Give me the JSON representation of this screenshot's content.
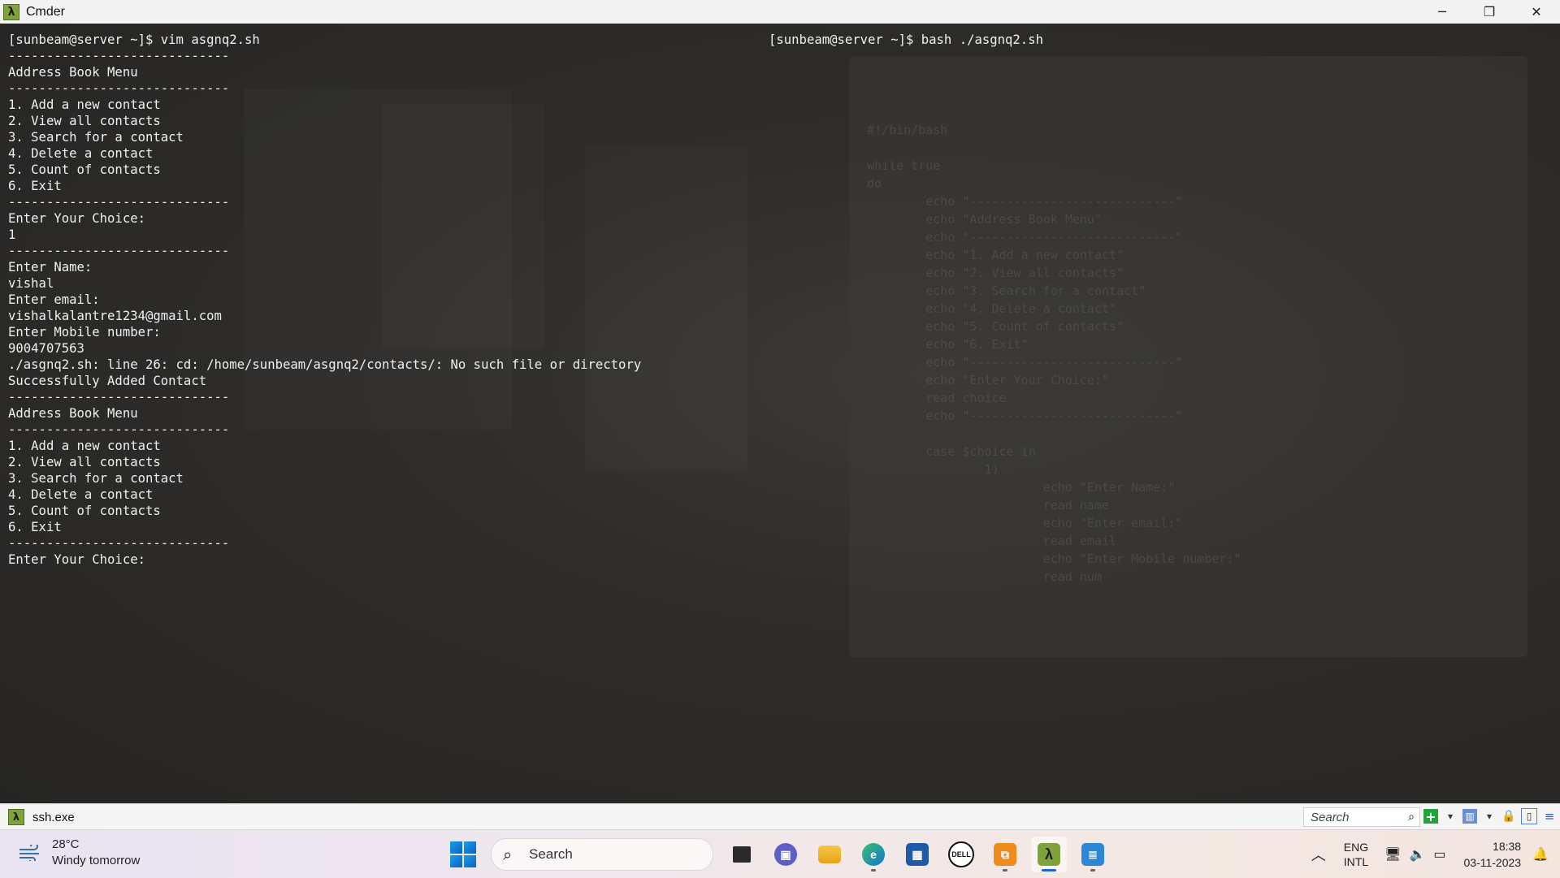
{
  "window": {
    "title": "Cmder",
    "app_icon": "λ",
    "controls": {
      "minimize": "─",
      "maximize": "❐",
      "close": "✕"
    }
  },
  "terminal": {
    "left_pane_text": "[sunbeam@server ~]$ vim asgnq2.sh\n-----------------------------\nAddress Book Menu\n-----------------------------\n1. Add a new contact\n2. View all contacts\n3. Search for a contact\n4. Delete a contact\n5. Count of contacts\n6. Exit\n-----------------------------\nEnter Your Choice:\n1\n-----------------------------\nEnter Name:\nvishal\nEnter email:\nvishalkalantre1234@gmail.com\nEnter Mobile number:\n9004707563\n./asgnq2.sh: line 26: cd: /home/sunbeam/asgnq2/contacts/: No such file or directory\nSuccessfully Added Contact\n-----------------------------\nAddress Book Menu\n-----------------------------\n1. Add a new contact\n2. View all contacts\n3. Search for a contact\n4. Delete a contact\n5. Count of contacts\n6. Exit\n-----------------------------\nEnter Your Choice:",
    "right_pane_text": "[sunbeam@server ~]$ bash ./asgnq2.sh"
  },
  "tabbar": {
    "tab_label": "ssh.exe",
    "search_placeholder": "Search"
  },
  "taskbar": {
    "weather_temp": "28°C",
    "weather_desc": "Windy tomorrow",
    "search_label": "Search",
    "lang_line1": "ENG",
    "lang_line2": "INTL",
    "time": "18:38",
    "date": "03-11-2023",
    "accent": "#1a64d4"
  }
}
